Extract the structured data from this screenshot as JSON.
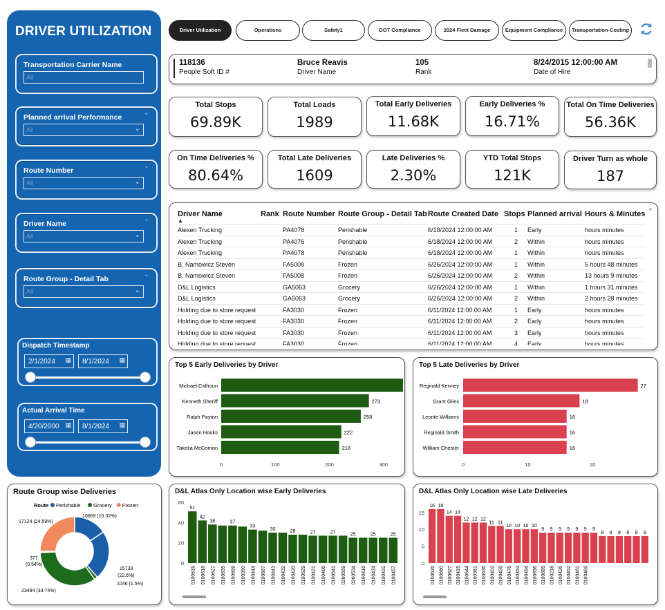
{
  "sidebar": {
    "title": "DRIVER UTILIZATION",
    "slicers": [
      {
        "label": "Transportation Carrier Name",
        "value": "All"
      },
      {
        "label": "Planned arrival Performance",
        "value": "All"
      },
      {
        "label": "Route Number",
        "value": "All"
      },
      {
        "label": "Driver Name",
        "value": "All"
      },
      {
        "label": "Route Group - Detail Tab",
        "value": "All"
      }
    ],
    "date_slicers": [
      {
        "label": "Dispatch Timestamp",
        "from": "2/1/2024",
        "to": "8/1/2024"
      },
      {
        "label": "Actual Arrival Time",
        "from": "4/20/2000",
        "to": "8/1/2024"
      }
    ]
  },
  "tabs": [
    "Driver Utilization",
    "Operations",
    "Safety1",
    "DOT Compliance",
    "2024 Fleet Damage",
    "Equipment Compliance",
    "Transportation-Costing"
  ],
  "active_tab": "Driver Utilization",
  "driver_info": [
    {
      "value": "118136",
      "label": "People Soft ID #"
    },
    {
      "value": "Bruce Reavis",
      "label": "Driver Name"
    },
    {
      "value": "105",
      "label": "Rank"
    },
    {
      "value": "8/24/2015 12:00:00 AM",
      "label": "Date of Hire"
    }
  ],
  "kpis": [
    {
      "title": "Total Stops",
      "value": "69.89K"
    },
    {
      "title": "Total Loads",
      "value": "1989"
    },
    {
      "title": "Total Early Deliveries",
      "value": "11.68K"
    },
    {
      "title": "Early Deliveries %",
      "value": "16.71%"
    },
    {
      "title": "Total On Time Deliveries",
      "value": "56.36K"
    },
    {
      "title": "On Time Deliveries %",
      "value": "80.64%"
    },
    {
      "title": "Total Late Deliveries",
      "value": "1609"
    },
    {
      "title": "Late Deliveries %",
      "value": "2.30%"
    },
    {
      "title": "YTD Total Stops",
      "value": "121K"
    },
    {
      "title": "Driver Turn as whole",
      "value": "187"
    }
  ],
  "table": {
    "columns": [
      "Driver Name",
      "Rank",
      "Route Number",
      "Route Group - Detail Tab",
      "Route Created Date",
      "Stops",
      "Planned arrival",
      "Hours & Minutes"
    ],
    "rows": [
      [
        "Alexen Trucking",
        "",
        "PA4078",
        "Perishable",
        "6/18/2024 12:00:00 AM",
        "1",
        "Early",
        "hours minutes"
      ],
      [
        "Alexen Trucking",
        "",
        "PA4076",
        "Perishable",
        "6/18/2024 12:00:00 AM",
        "2",
        "Within",
        "hours minutes"
      ],
      [
        "Alexen Trucking",
        "",
        "PA4078",
        "Perishable",
        "6/18/2024 12:00:00 AM",
        "1",
        "Within",
        "hours minutes"
      ],
      [
        "B, Namowicz Steven",
        "",
        "FA5008",
        "Frozen",
        "6/26/2024 12:00:00 AM",
        "1",
        "Within",
        "5 hours 48 minutes"
      ],
      [
        "B, Namowicz Steven",
        "",
        "FA5008",
        "Frozen",
        "6/26/2024 12:00:00 AM",
        "2",
        "Within",
        "13 hours 9 minutes"
      ],
      [
        "D&L Logistics",
        "",
        "GA5063",
        "Grocery",
        "6/26/2024 12:00:00 AM",
        "1",
        "Within",
        "1 hours 31 minutes"
      ],
      [
        "D&L Logistics",
        "",
        "GA5063",
        "Grocery",
        "6/26/2024 12:00:00 AM",
        "2",
        "Within",
        "2 hours 28 minutes"
      ],
      [
        "Holding due to store request",
        "",
        "FA3030",
        "Frozen",
        "6/11/2024 12:00:00 AM",
        "1",
        "Early",
        "hours minutes"
      ],
      [
        "Holding due to store request",
        "",
        "FA3030",
        "Frozen",
        "6/11/2024 12:00:00 AM",
        "2",
        "Early",
        "hours minutes"
      ],
      [
        "Holding due to store request",
        "",
        "FA3030",
        "Frozen",
        "6/11/2024 12:00:00 AM",
        "3",
        "Early",
        "hours minutes"
      ],
      [
        "Holding due to store request",
        "",
        "FA3030",
        "Frozen",
        "6/11/2024 12:00:00 AM",
        "4",
        "Early",
        "hours minutes"
      ]
    ]
  },
  "colors": {
    "accent": "#1564b0",
    "early": "#1e5c12",
    "late": "#d9414f",
    "perishable": "#1a5ea8",
    "grocery": "#1e6b1e",
    "frozen": "#f08a5d"
  },
  "chart_data": [
    {
      "type": "bar",
      "orientation": "horizontal",
      "title": "Top 5 Early Deliveries by Driver",
      "categories": [
        "Michael Calhoun",
        "Kenneth Sheriff",
        "Ralph Payton",
        "Jason Hooks",
        "Takelia McCrimon"
      ],
      "values": [
        336,
        273,
        258,
        222,
        218
      ],
      "xticks": [
        "0",
        "100",
        "200",
        "300"
      ],
      "xlim": [
        0,
        345
      ]
    },
    {
      "type": "bar",
      "orientation": "horizontal",
      "title": "Top 5 Late Deliveries by Driver",
      "categories": [
        "Reginald Kenney",
        "Grant Giles",
        "Leonte Williams",
        "Reginald Smith",
        "William Chester"
      ],
      "values": [
        27,
        18,
        16,
        16,
        16
      ],
      "xticks": [
        "0",
        "10",
        "20"
      ],
      "xlim": [
        0,
        28
      ]
    },
    {
      "type": "pie",
      "title": "Route Group wise Deliveries",
      "legend_title": "Route",
      "series": [
        {
          "name": "Perishable",
          "value": 10669,
          "label": "10669 (15.32%)"
        },
        {
          "name": "Perishable",
          "value": 15739,
          "label": "15739 (22.6%)"
        },
        {
          "name": "Grocery",
          "value": 1046,
          "label": "1046 (1.5%)"
        },
        {
          "name": "Grocery",
          "value": 23494,
          "label": "23494 (33.74%)"
        },
        {
          "name": "Frozen",
          "value": 377,
          "label": "377 (0.54%)"
        },
        {
          "name": "Frozen",
          "value": 17124,
          "label": "17124 (24.59%)"
        }
      ],
      "legend": [
        "Perishable",
        "Grocery",
        "Frozen"
      ]
    },
    {
      "type": "bar",
      "title": "D&L Atlas Only Location wise Early Deliveries",
      "categories": [
        "0100619",
        "0100618",
        "0100627",
        "0100695",
        "0100699",
        "0100390",
        "0100444",
        "0100687",
        "0100443",
        "0100432",
        "0100420",
        "0100629",
        "0100421",
        "0100486",
        "0100641",
        "0260559",
        "0260534",
        "0100416",
        "0100424",
        "0100431",
        "0100457"
      ],
      "values": [
        51,
        42,
        38,
        37,
        37,
        36,
        33,
        32,
        30,
        30,
        28,
        28,
        27,
        27,
        27,
        27,
        25,
        25,
        25,
        25,
        25
      ],
      "labels": [
        "51",
        "42",
        "38",
        "",
        "37",
        "",
        "33",
        "",
        "30",
        "",
        "28",
        "",
        "27",
        "",
        "27",
        "",
        "25",
        "",
        "25",
        "",
        "25"
      ],
      "yticks": [
        "0",
        "20",
        "40",
        "60"
      ],
      "ylim": [
        0,
        60
      ]
    },
    {
      "type": "bar",
      "title": "D&L Atlas Only Location wise Late Deliveries",
      "categories": [
        "0100626",
        "0100680",
        "0100627",
        "0100415",
        "0100644",
        "0100381",
        "0100635",
        "0100402",
        "0100459",
        "0100476",
        "0100453",
        "0100494",
        "0100656",
        "0100685",
        "0100218",
        "0100426",
        "0100452",
        "0100461",
        "0100469"
      ],
      "values": [
        16,
        16,
        14,
        14,
        12,
        12,
        12,
        11,
        11,
        10,
        10,
        10,
        10,
        9,
        9,
        9,
        9,
        9,
        9,
        9,
        8,
        8,
        8,
        8,
        8,
        8
      ],
      "labels": [
        "16",
        "16",
        "14",
        "14",
        "12",
        "12",
        "12",
        "11",
        "11",
        "10",
        "10",
        "10",
        "10",
        "9",
        "9",
        "9",
        "9",
        "9",
        "9",
        "9",
        "8",
        "8",
        "8",
        "8",
        "8",
        "8"
      ],
      "yticks": [
        "0",
        "5",
        "10",
        "15"
      ],
      "ylim": [
        0,
        17
      ]
    }
  ]
}
